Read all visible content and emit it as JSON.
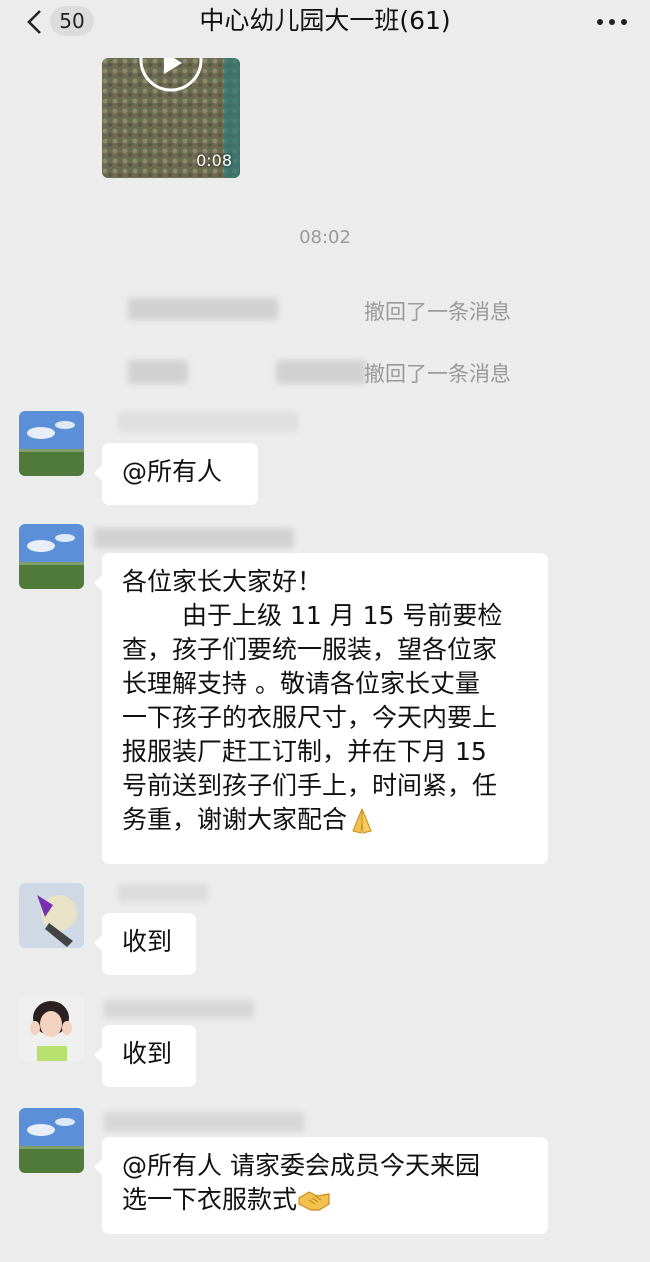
{
  "header": {
    "back_label": "back",
    "unread_count": "50",
    "title": "中心幼儿园大一班(61)",
    "more_label": "more"
  },
  "video": {
    "duration": "0:08"
  },
  "timestamp": "08:02",
  "system_messages": [
    {
      "text": "撤回了一条消息"
    },
    {
      "text": "撤回了一条消息"
    }
  ],
  "messages": [
    {
      "lines": [
        "@所有人"
      ]
    },
    {
      "lines": [
        "各位家长大家好！",
        "由于上级 11 月 15 号前要检",
        "查，孩子们要统一服装，望各位家",
        "长理解支持 。敬请各位家长丈量",
        "一下孩子的衣服尺寸，今天内要上",
        "报服装厂赶工订制，并在下月 15",
        "号前送到孩子们手上，时间紧，任",
        "务重，谢谢大家配合"
      ],
      "emoji": "folded-hands"
    },
    {
      "lines": [
        "收到"
      ]
    },
    {
      "lines": [
        "收到"
      ]
    },
    {
      "lines": [
        "@所有人  请家委会成员今天来园",
        "选一下衣服款式"
      ],
      "emoji": "handshake"
    }
  ],
  "colors": {
    "background": "#ececec",
    "bubble": "#ffffff",
    "system_text": "#9a9a9a"
  }
}
